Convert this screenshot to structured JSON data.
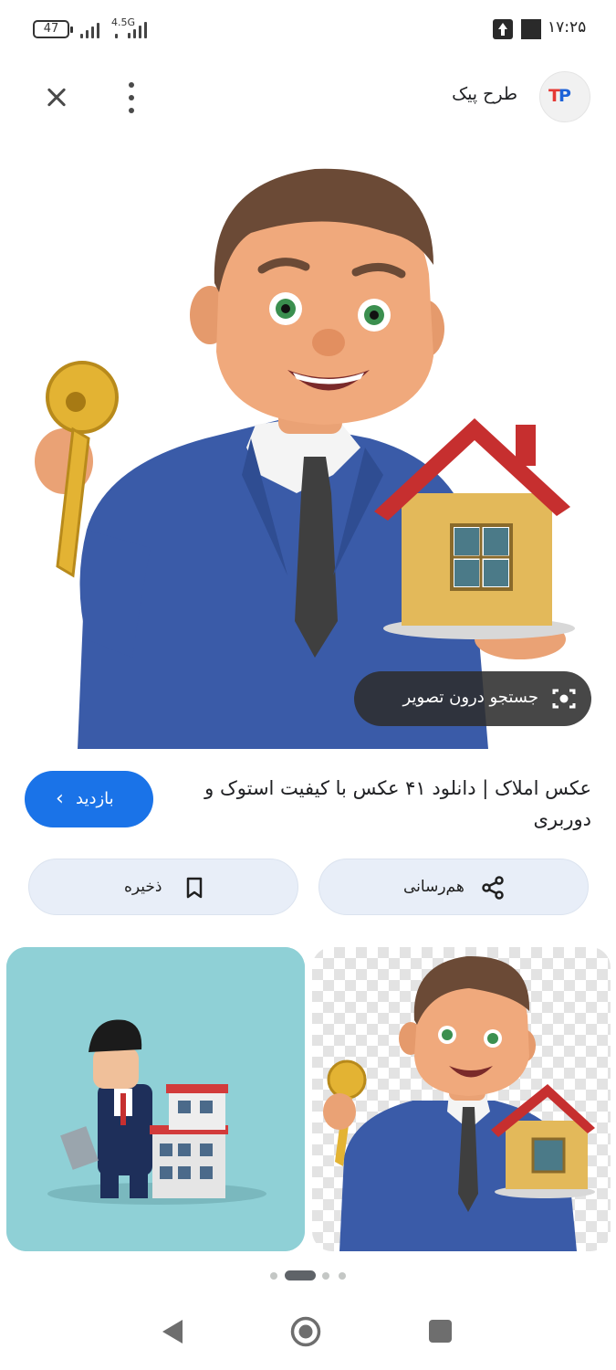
{
  "status_bar": {
    "battery_level": "47",
    "network_type": "4.5G",
    "time": "۱۷:۲۵"
  },
  "header": {
    "site_name": "طرح پیک",
    "logo_text_t": "T",
    "logo_text_p": "P"
  },
  "image_overlay": {
    "lens_label": "جستجو درون تصویر"
  },
  "result": {
    "title": "عکس املاک | دانلود ۴۱ عکس با کیفیت استوک و دوربری",
    "visit_label": "بازدید",
    "visit_icon": "chevron-left-icon"
  },
  "actions": {
    "share_label": "هم‌رسانی",
    "save_label": "ذخیره"
  },
  "pagination": {
    "total_dots": 4,
    "active_index": 1
  },
  "colors": {
    "accent": "#1a73e8",
    "action_bg": "#e8eef8",
    "suit": "#3a5ba8",
    "roof": "#c62f2f",
    "house_wall": "#e3b95a"
  }
}
